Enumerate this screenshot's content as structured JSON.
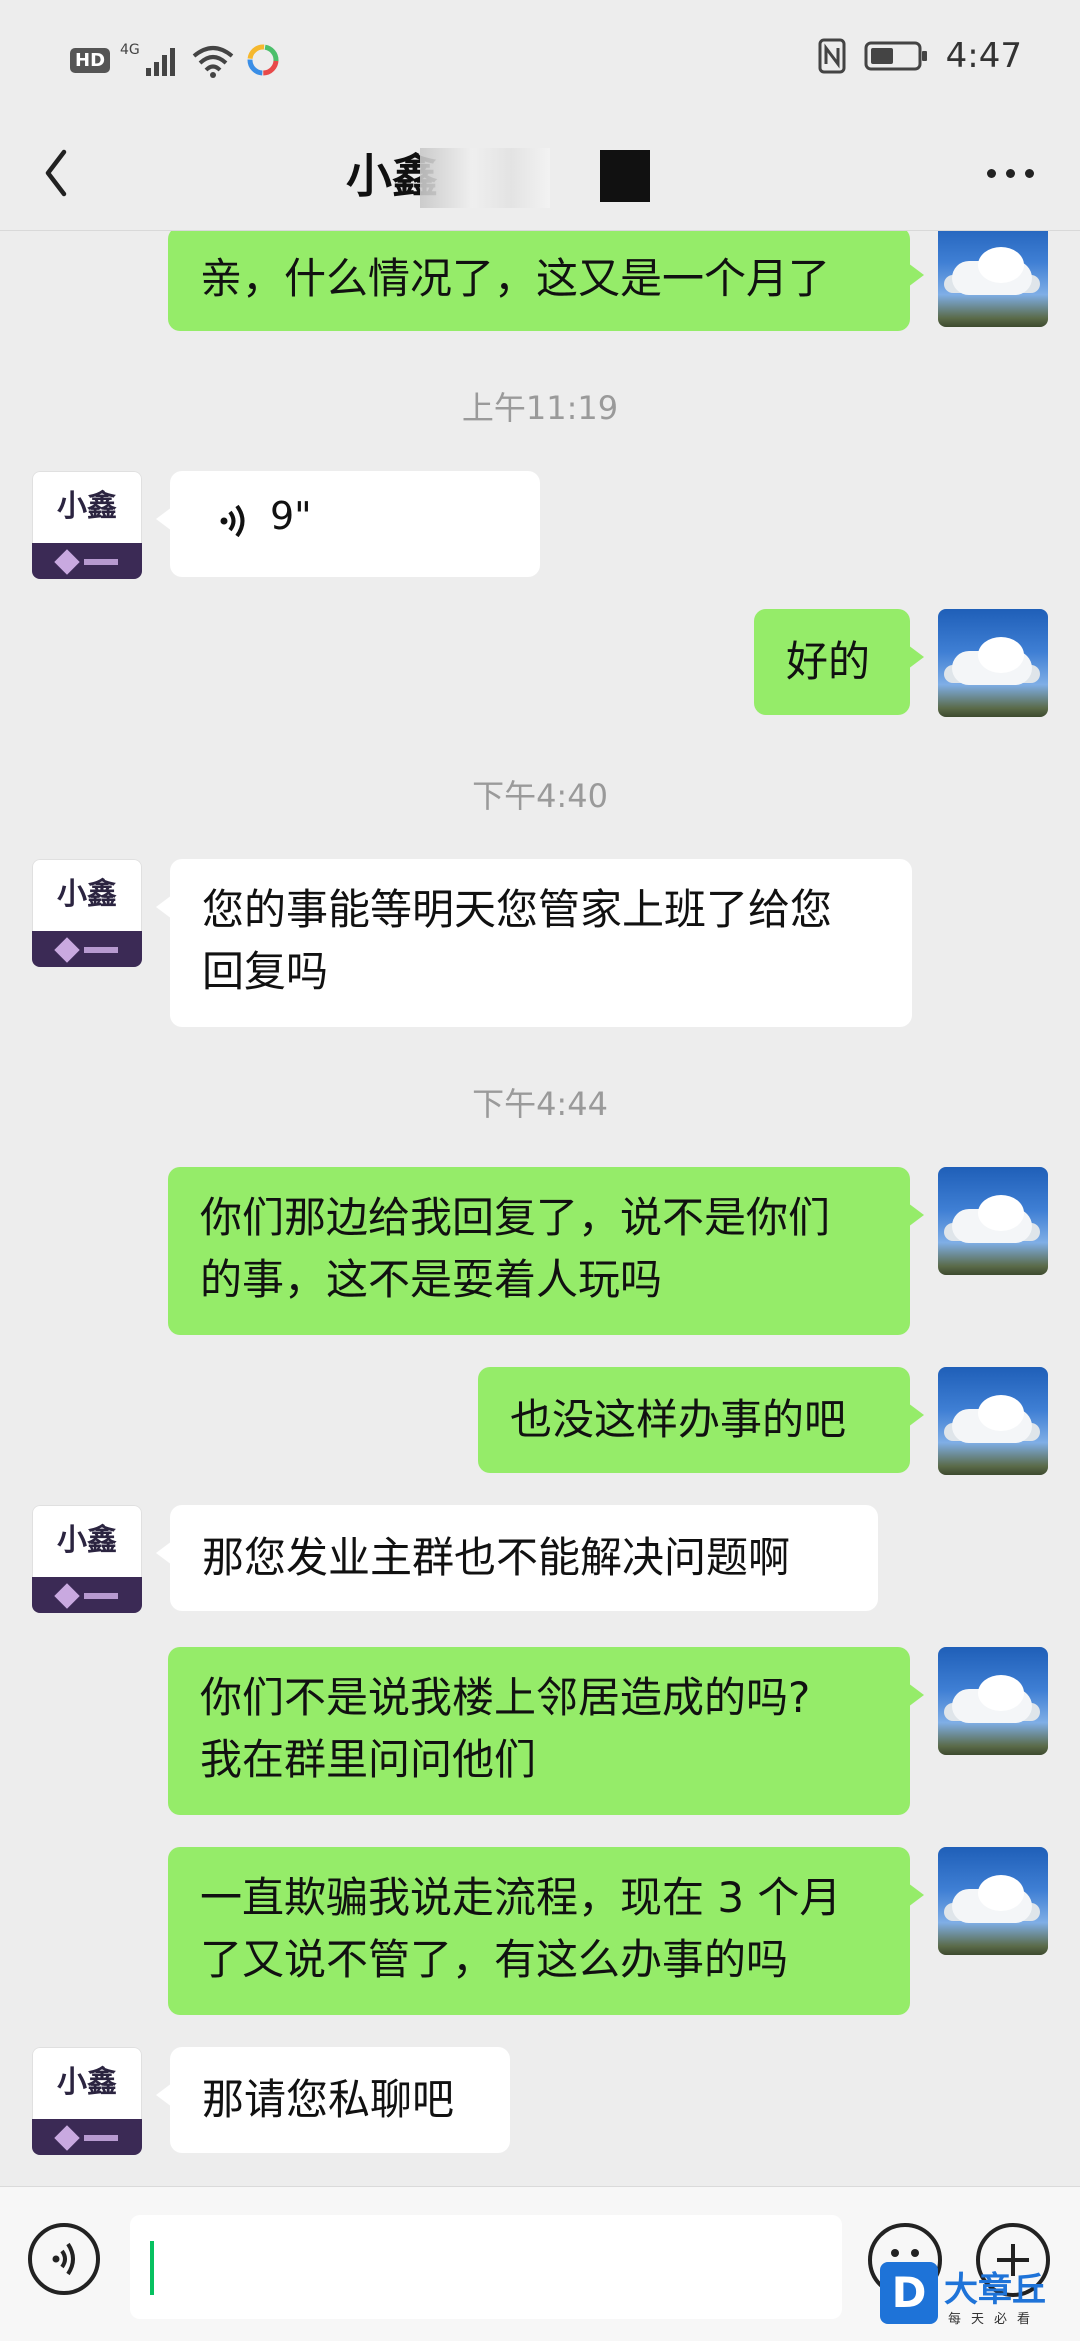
{
  "status_bar": {
    "network_badge": "HD",
    "network_type": "4G",
    "time": "4:47",
    "icons": [
      "signal-icon",
      "wifi-icon",
      "app-icon",
      "nfc-icon",
      "battery-icon"
    ]
  },
  "header": {
    "title": "小鑫",
    "back_icon": "chevron-left-icon",
    "more_icon": "more-dots-icon"
  },
  "messages": [
    {
      "sender": "me",
      "text": "亲，什么情况了，这又是一个月了"
    },
    {
      "type": "time",
      "text": "上午11:19"
    },
    {
      "sender": "them",
      "type": "voice",
      "duration": "9\""
    },
    {
      "sender": "me",
      "text": "好的"
    },
    {
      "type": "time",
      "text": "下午4:40"
    },
    {
      "sender": "them",
      "lines": [
        "您的事能等明天您管家上班了给您",
        "回复吗"
      ]
    },
    {
      "type": "time",
      "text": "下午4:44"
    },
    {
      "sender": "me",
      "lines": [
        "你们那边给我回复了，说不是你们",
        "的事，这不是耍着人玩吗"
      ]
    },
    {
      "sender": "me",
      "text": "也没这样办事的吧"
    },
    {
      "sender": "them",
      "text": "那您发业主群也不能解决问题啊"
    },
    {
      "sender": "me",
      "lines": [
        "你们不是说我楼上邻居造成的吗?",
        "我在群里问问他们"
      ]
    },
    {
      "sender": "me",
      "lines": [
        "一直欺骗我说走流程，现在 3 个月",
        "了又说不管了，有这么办事的吗"
      ]
    },
    {
      "sender": "them",
      "text": "那请您私聊吧"
    }
  ],
  "contact_avatar": {
    "logo_text": "小鑫"
  },
  "input_bar": {
    "placeholder": "",
    "icons": [
      "voice-toggle-icon",
      "emoji-icon",
      "plus-icon"
    ]
  },
  "watermark": {
    "logo": "D",
    "name": "大章丘",
    "tagline": "每天必看"
  },
  "colors": {
    "my_bubble": "#95ec69",
    "their_bubble": "#ffffff",
    "background": "#ededed",
    "caret": "#07c160"
  }
}
